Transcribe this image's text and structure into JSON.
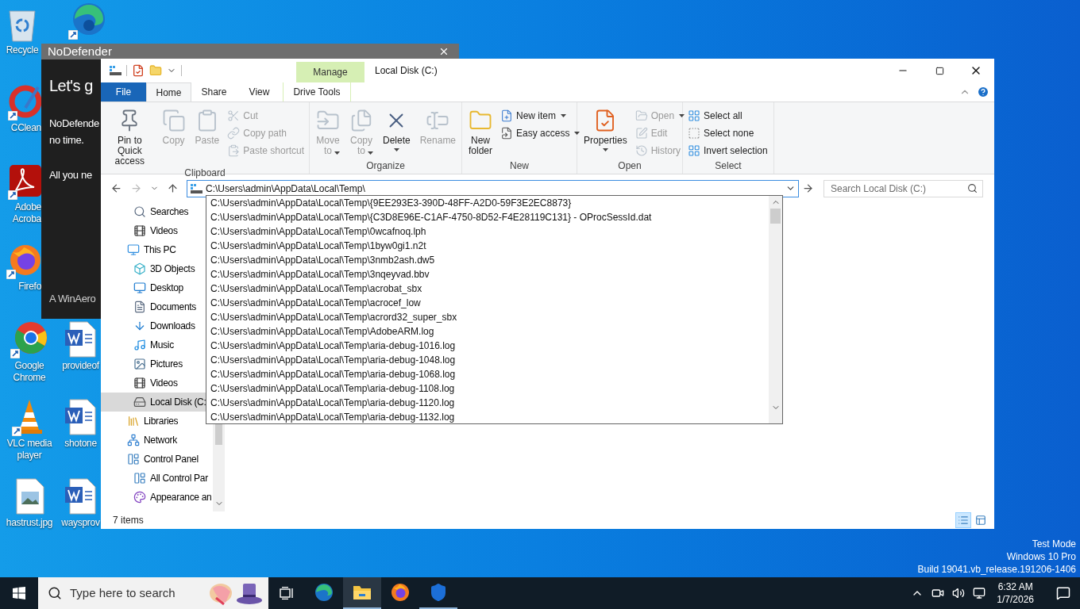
{
  "desktop": {
    "icons": [
      {
        "label": "Recycle",
        "kind": "file"
      },
      {
        "kind": "shortcut"
      },
      {
        "label": "CClean",
        "kind": "shortcut"
      },
      {
        "label": "Adobe\nAcroba",
        "kind": "shortcut"
      },
      {
        "label": "Firefo",
        "kind": "shortcut"
      },
      {
        "label": "Google\nChrome",
        "kind": "shortcut"
      },
      {
        "label": "provideof",
        "kind": "file"
      },
      {
        "label": "VLC media\nplayer",
        "kind": "shortcut"
      },
      {
        "label": "shotone",
        "kind": "file"
      },
      {
        "label": "hastrust.jpg",
        "kind": "file"
      },
      {
        "label": "waysprov",
        "kind": "file"
      }
    ],
    "system_notice": [
      "Test Mode",
      "Windows 10 Pro",
      "Build 19041.vb_release.191206-1406"
    ]
  },
  "nodefender": {
    "title": "NoDefender",
    "heading": "Let's g",
    "lines": [
      "NoDefende",
      "no time."
    ],
    "line_2": "All you ne",
    "footer": "A WinAero"
  },
  "explorer": {
    "title": "Local Disk (C:)",
    "context_tab": {
      "group": "Manage",
      "label": "Drive Tools",
      "selected": false
    },
    "tabs": [
      {
        "label": "File",
        "kind": "file",
        "selected": false
      },
      {
        "label": "Home",
        "kind": "tab",
        "selected": true
      },
      {
        "label": "Share",
        "kind": "tab",
        "selected": false
      },
      {
        "label": "View",
        "kind": "tab",
        "selected": false
      }
    ],
    "ribbon": {
      "groups": [
        {
          "label": "Clipboard",
          "commands": [
            {
              "label": "Pin to Quick\naccess",
              "kind": "large",
              "disabled": false,
              "dropdown": false
            },
            {
              "label": "Copy",
              "kind": "large",
              "disabled": true,
              "dropdown": false
            },
            {
              "label": "Paste",
              "kind": "large",
              "disabled": true,
              "dropdown": false
            },
            {
              "label": "Cut",
              "kind": "small",
              "disabled": true,
              "dropdown": false
            },
            {
              "label": "Copy path",
              "kind": "small",
              "disabled": true,
              "dropdown": false
            },
            {
              "label": "Paste shortcut",
              "kind": "small",
              "disabled": true,
              "dropdown": false
            }
          ]
        },
        {
          "label": "Organize",
          "commands": [
            {
              "label": "Move\nto",
              "kind": "large",
              "disabled": true,
              "dropdown": true
            },
            {
              "label": "Copy\nto",
              "kind": "large",
              "disabled": true,
              "dropdown": true
            },
            {
              "label": "Delete",
              "kind": "large",
              "disabled": false,
              "dropdown": true
            },
            {
              "label": "Rename",
              "kind": "large",
              "disabled": true,
              "dropdown": false
            }
          ]
        },
        {
          "label": "New",
          "commands": [
            {
              "label": "New\nfolder",
              "kind": "large",
              "disabled": false,
              "dropdown": false
            },
            {
              "label": "New item",
              "kind": "small",
              "disabled": false,
              "dropdown": true
            },
            {
              "label": "Easy access",
              "kind": "small",
              "disabled": false,
              "dropdown": true
            }
          ]
        },
        {
          "label": "Open",
          "commands": [
            {
              "label": "Properties",
              "kind": "large",
              "disabled": false,
              "dropdown": true
            },
            {
              "label": "Open",
              "kind": "small",
              "disabled": true,
              "dropdown": true
            },
            {
              "label": "Edit",
              "kind": "small",
              "disabled": true,
              "dropdown": false
            },
            {
              "label": "History",
              "kind": "small",
              "disabled": true,
              "dropdown": false
            }
          ]
        },
        {
          "label": "Select",
          "commands": [
            {
              "label": "Select all",
              "kind": "small",
              "disabled": false,
              "dropdown": false
            },
            {
              "label": "Select none",
              "kind": "small",
              "disabled": false,
              "dropdown": false
            },
            {
              "label": "Invert selection",
              "kind": "small",
              "disabled": false,
              "dropdown": false
            }
          ]
        }
      ]
    },
    "address": {
      "value": "C:\\Users\\admin\\AppData\\Local\\Temp\\"
    },
    "search": {
      "placeholder": "Search Local Disk (C:)"
    },
    "autocomplete": {
      "items": [
        "C:\\Users\\admin\\AppData\\Local\\Temp\\{9EE293E3-390D-48FF-A2D0-59F3E2EC8873}",
        "C:\\Users\\admin\\AppData\\Local\\Temp\\{C3D8E96E-C1AF-4750-8D52-F4E28119C131} - OProcSessId.dat",
        "C:\\Users\\admin\\AppData\\Local\\Temp\\0wcafnoq.lph",
        "C:\\Users\\admin\\AppData\\Local\\Temp\\1byw0gi1.n2t",
        "C:\\Users\\admin\\AppData\\Local\\Temp\\3nmb2ash.dw5",
        "C:\\Users\\admin\\AppData\\Local\\Temp\\3nqeyvad.bbv",
        "C:\\Users\\admin\\AppData\\Local\\Temp\\acrobat_sbx",
        "C:\\Users\\admin\\AppData\\Local\\Temp\\acrocef_low",
        "C:\\Users\\admin\\AppData\\Local\\Temp\\acrord32_super_sbx",
        "C:\\Users\\admin\\AppData\\Local\\Temp\\AdobeARM.log",
        "C:\\Users\\admin\\AppData\\Local\\Temp\\aria-debug-1016.log",
        "C:\\Users\\admin\\AppData\\Local\\Temp\\aria-debug-1048.log",
        "C:\\Users\\admin\\AppData\\Local\\Temp\\aria-debug-1068.log",
        "C:\\Users\\admin\\AppData\\Local\\Temp\\aria-debug-1108.log",
        "C:\\Users\\admin\\AppData\\Local\\Temp\\aria-debug-1120.log",
        "C:\\Users\\admin\\AppData\\Local\\Temp\\aria-debug-1132.log"
      ]
    },
    "nav": [
      {
        "children": [
          {
            "label": "Searches",
            "selected": false
          },
          {
            "label": "Videos",
            "selected": false
          }
        ]
      },
      {
        "label": "This PC",
        "selected": false,
        "children": [
          {
            "label": "3D Objects",
            "selected": false
          },
          {
            "label": "Desktop",
            "selected": false
          },
          {
            "label": "Documents",
            "selected": false
          },
          {
            "label": "Downloads",
            "selected": false
          },
          {
            "label": "Music",
            "selected": false
          },
          {
            "label": "Pictures",
            "selected": false
          },
          {
            "label": "Videos",
            "selected": false
          },
          {
            "label": "Local Disk (C:",
            "selected": true
          }
        ]
      },
      {
        "label": "Libraries",
        "selected": false
      },
      {
        "label": "Network",
        "selected": false
      },
      {
        "label": "Control Panel",
        "selected": false,
        "children": [
          {
            "label": "All Control Par",
            "selected": false
          },
          {
            "label": "Appearance an",
            "selected": false
          }
        ]
      }
    ],
    "status": "7 items",
    "views": [
      {
        "selected": true
      },
      {
        "selected": false
      }
    ]
  },
  "taskbar": {
    "search": {
      "placeholder": "Type here to search"
    },
    "apps": [
      {
        "selected": false,
        "open": false
      },
      {
        "selected": true,
        "open": true
      },
      {
        "selected": false,
        "open": false
      },
      {
        "selected": false,
        "open": true
      }
    ],
    "clock": {
      "time": "6:32 AM",
      "date": "1/7/2026"
    }
  }
}
